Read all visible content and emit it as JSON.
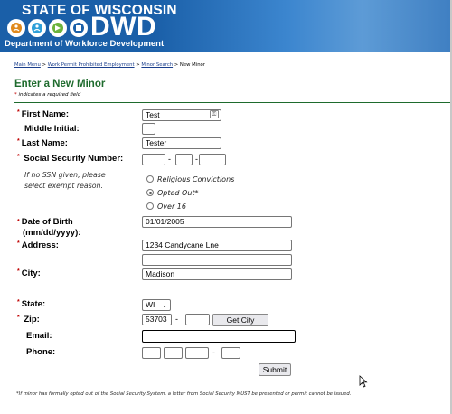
{
  "header": {
    "state_title": "STATE OF WISCONSIN",
    "agency_abbr": "DWD",
    "agency_name": "Department of Workforce Development"
  },
  "breadcrumb": {
    "items": [
      "Main Menu",
      "Work Permit Prohibited Employment",
      "Minor Search"
    ],
    "separator": ">",
    "current": "New Minor"
  },
  "page": {
    "title": "Enter a New Minor",
    "required_note": " indicates a required field",
    "required_marker": "*"
  },
  "form": {
    "first_name": {
      "label": "First Name:",
      "value": "Test",
      "required": true
    },
    "middle_initial": {
      "label": "Middle Initial:",
      "value": ""
    },
    "last_name": {
      "label": "Last Name:",
      "value": "Tester",
      "required": true
    },
    "ssn": {
      "label": "Social Security Number:",
      "parts": [
        "",
        "",
        ""
      ],
      "separator": "-",
      "required": true
    },
    "ssn_note": {
      "line1": "If no SSN given, please",
      "line2": "select exempt reason."
    },
    "exempt_options": [
      {
        "label": "Religious Convictions",
        "checked": false
      },
      {
        "label": "Opted Out*",
        "checked": true
      },
      {
        "label": "Over 16",
        "checked": false
      }
    ],
    "dob": {
      "label_line1": "Date of Birth",
      "label_line2": "(mm/dd/yyyy):",
      "value": "01/01/2005",
      "required": true
    },
    "address": {
      "label": "Address:",
      "line1": "1234 Candycane Lne",
      "line2": "",
      "required": true
    },
    "city": {
      "label": "City:",
      "value": "Madison",
      "required": true
    },
    "state": {
      "label": "State:",
      "value": "WI",
      "required": true
    },
    "zip": {
      "label": "Zip:",
      "value": "53703",
      "ext": "",
      "separator": "-",
      "required": true
    },
    "get_city_button": "Get City",
    "email": {
      "label": "Email:",
      "value": ""
    },
    "phone": {
      "label": "Phone:",
      "parts": [
        "",
        "",
        "",
        ""
      ],
      "separator": "-"
    },
    "submit_button": "Submit"
  },
  "footnote": "*If minor has formally opted out of the Social Security System, a letter from Social Security MUST be presented or permit cannot be issued.",
  "colors": {
    "header_blue": "#1a5fa8",
    "title_green": "#1e6b2d",
    "required_red": "#c00000",
    "link_blue": "#1a3e8c"
  },
  "icons": [
    "wisconsin-dwd-logo-icon",
    "autofill-key-icon",
    "chevron-down-icon",
    "mouse-pointer-icon"
  ]
}
